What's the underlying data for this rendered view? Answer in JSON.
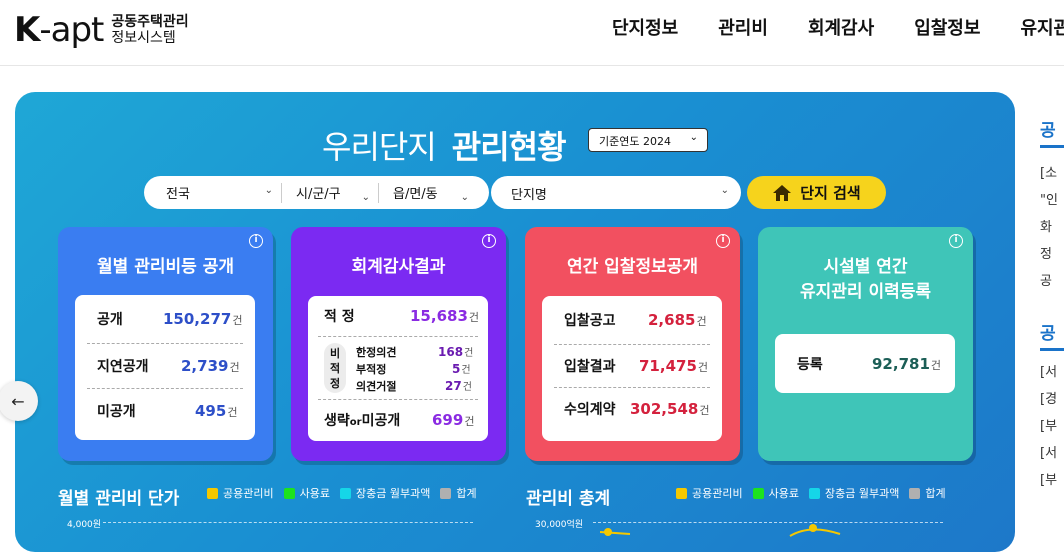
{
  "logo": {
    "brand_k": "K",
    "brand_apt": "-apt",
    "line1": "공동주택관리",
    "line2": "정보시스템"
  },
  "nav": {
    "items": [
      "단지정보",
      "관리비",
      "회계감사",
      "입찰정보",
      "유지관"
    ]
  },
  "hero": {
    "title_light": "우리단지",
    "title_bold": "관리현황",
    "year_select": "기준연도 2024",
    "search": {
      "region1": "전국",
      "region2": "시/군/구",
      "region3": "읍/면/동",
      "complex_name": "단지명",
      "button": "단지 검색"
    }
  },
  "cards": [
    {
      "title": "월별 관리비등 공개",
      "rows": [
        {
          "label": "공개",
          "value": "150,277",
          "unit": "건"
        },
        {
          "label": "지연공개",
          "value": "2,739",
          "unit": "건"
        },
        {
          "label": "미공개",
          "value": "495",
          "unit": "건"
        }
      ]
    },
    {
      "title": "회계감사결과",
      "top": {
        "label": "적 정",
        "value": "15,683",
        "unit": "건"
      },
      "group_label": "비적정",
      "group": [
        {
          "label": "한정의견",
          "value": "168",
          "unit": "건"
        },
        {
          "label": "부적정",
          "value": "5",
          "unit": "건"
        },
        {
          "label": "의견거절",
          "value": "27",
          "unit": "건"
        }
      ],
      "bottom": {
        "label_a": "생략",
        "label_or": "or",
        "label_b": "미공개",
        "value": "699",
        "unit": "건"
      }
    },
    {
      "title": "연간 입찰정보공개",
      "rows": [
        {
          "label": "입찰공고",
          "value": "2,685",
          "unit": "건"
        },
        {
          "label": "입찰결과",
          "value": "71,475",
          "unit": "건"
        },
        {
          "label": "수의계약",
          "value": "302,548",
          "unit": "건"
        }
      ]
    },
    {
      "title_line1": "시설별 연간",
      "title_line2": "유지관리 이력등록",
      "rows": [
        {
          "label": "등록",
          "value": "92,781",
          "unit": "건"
        }
      ]
    }
  ],
  "charts": {
    "left_title": "월별 관리비 단가",
    "right_title": "관리비 총계",
    "legend": [
      {
        "label": "공용관리비",
        "color": "#f5c800"
      },
      {
        "label": "사용료",
        "color": "#1de31d"
      },
      {
        "label": "장충금 월부과액",
        "color": "#15d6e8"
      },
      {
        "label": "합계",
        "color": "#b0b0b0"
      }
    ],
    "left_axis_top": "4,000원",
    "right_axis_top": "30,000억원"
  },
  "side": {
    "lines": [
      "공",
      "[소",
      "\"인",
      "화",
      "정",
      "공"
    ],
    "head2": "공",
    "lines2": [
      "[서",
      "[경",
      "[부",
      "[서",
      "[부"
    ]
  },
  "colors": {
    "card1": "#3a7df1",
    "card2": "#7b2af2",
    "card3": "#f25060",
    "card4": "#3fc5b8",
    "search_button": "#f6d31c",
    "value_blue": "#2d4fc8",
    "value_purple": "#8a2be2",
    "value_red": "#d4213d",
    "value_teal": "#1b5e56"
  }
}
